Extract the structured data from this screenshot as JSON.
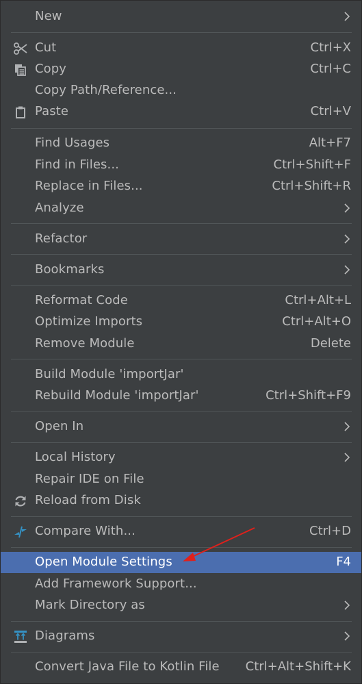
{
  "menu": {
    "items": [
      {
        "label": "New",
        "shortcut": "",
        "submenu": true
      },
      {
        "label": "Cut",
        "shortcut": "Ctrl+X",
        "icon": "scissors-icon"
      },
      {
        "label": "Copy",
        "shortcut": "Ctrl+C",
        "icon": "copy-icon"
      },
      {
        "label": "Copy Path/Reference...",
        "shortcut": ""
      },
      {
        "label": "Paste",
        "shortcut": "Ctrl+V",
        "icon": "clipboard-icon"
      },
      {
        "label": "Find Usages",
        "shortcut": "Alt+F7"
      },
      {
        "label": "Find in Files...",
        "shortcut": "Ctrl+Shift+F"
      },
      {
        "label": "Replace in Files...",
        "shortcut": "Ctrl+Shift+R"
      },
      {
        "label": "Analyze",
        "shortcut": "",
        "submenu": true
      },
      {
        "label": "Refactor",
        "shortcut": "",
        "submenu": true
      },
      {
        "label": "Bookmarks",
        "shortcut": "",
        "submenu": true
      },
      {
        "label": "Reformat Code",
        "shortcut": "Ctrl+Alt+L"
      },
      {
        "label": "Optimize Imports",
        "shortcut": "Ctrl+Alt+O"
      },
      {
        "label": "Remove Module",
        "shortcut": "Delete"
      },
      {
        "label": "Build Module 'importJar'",
        "shortcut": ""
      },
      {
        "label": "Rebuild Module 'importJar'",
        "shortcut": "Ctrl+Shift+F9"
      },
      {
        "label": "Open In",
        "shortcut": "",
        "submenu": true
      },
      {
        "label": "Local History",
        "shortcut": "",
        "submenu": true
      },
      {
        "label": "Repair IDE on File",
        "shortcut": ""
      },
      {
        "label": "Reload from Disk",
        "shortcut": "",
        "icon": "reload-icon"
      },
      {
        "label": "Compare With...",
        "shortcut": "Ctrl+D",
        "icon": "compare-icon"
      },
      {
        "label": "Open Module Settings",
        "shortcut": "F4",
        "selected": true
      },
      {
        "label": "Add Framework Support...",
        "shortcut": ""
      },
      {
        "label": "Mark Directory as",
        "shortcut": "",
        "submenu": true
      },
      {
        "label": "Diagrams",
        "shortcut": "",
        "submenu": true,
        "icon": "diagrams-icon"
      },
      {
        "label": "Convert Java File to Kotlin File",
        "shortcut": "Ctrl+Alt+Shift+K"
      }
    ]
  },
  "colors": {
    "background": "#3c3f41",
    "text": "#bbbbbb",
    "selected_background": "#4b6eaf",
    "annotation_arrow": "#e0201b"
  }
}
